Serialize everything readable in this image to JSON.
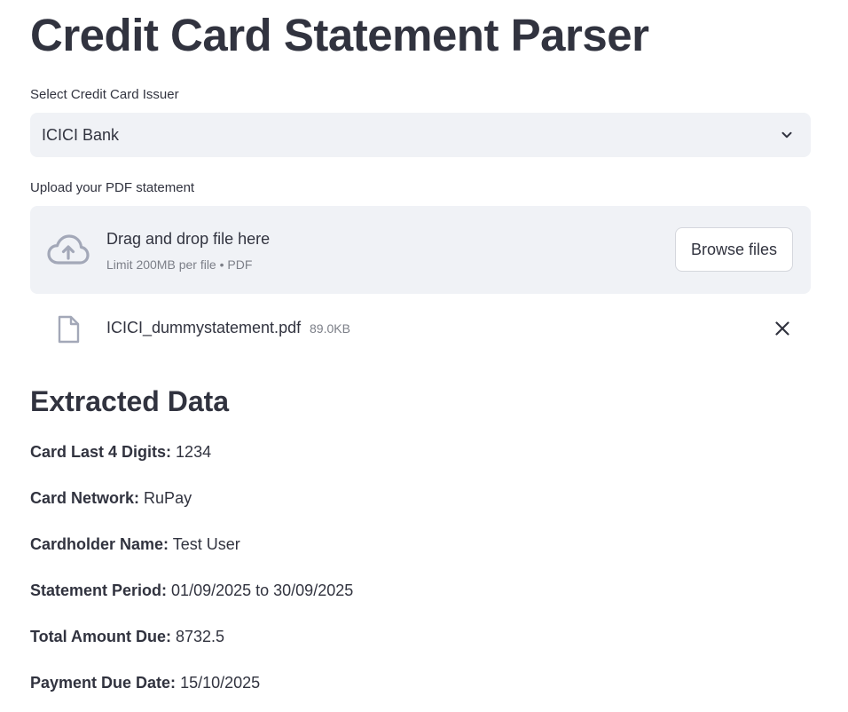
{
  "page": {
    "title": "Credit Card Statement Parser"
  },
  "issuer_select": {
    "label": "Select Credit Card Issuer",
    "value": "ICICI Bank",
    "icon": "chevron-down-icon"
  },
  "uploader": {
    "label": "Upload your PDF statement",
    "drop_text": "Drag and drop file here",
    "limit_text": "Limit 200MB per file • PDF",
    "browse_label": "Browse files",
    "icon": "cloud-upload-icon"
  },
  "uploaded_file": {
    "name": "ICICI_dummystatement.pdf",
    "size": "89.0KB",
    "icon": "file-icon",
    "remove_icon": "close-icon"
  },
  "extracted": {
    "heading": "Extracted Data",
    "fields": [
      {
        "key": "Card Last 4 Digits:",
        "value": "1234"
      },
      {
        "key": "Card Network:",
        "value": "RuPay"
      },
      {
        "key": "Cardholder Name:",
        "value": "Test User"
      },
      {
        "key": "Statement Period:",
        "value": "01/09/2025 to 30/09/2025"
      },
      {
        "key": "Total Amount Due:",
        "value": "8732.5"
      },
      {
        "key": "Payment Due Date:",
        "value": "15/10/2025"
      }
    ]
  },
  "colors": {
    "text": "#31333f",
    "muted": "#7c7f88",
    "widget_bg": "#f0f2f6",
    "icon": "#a3a8b8"
  }
}
